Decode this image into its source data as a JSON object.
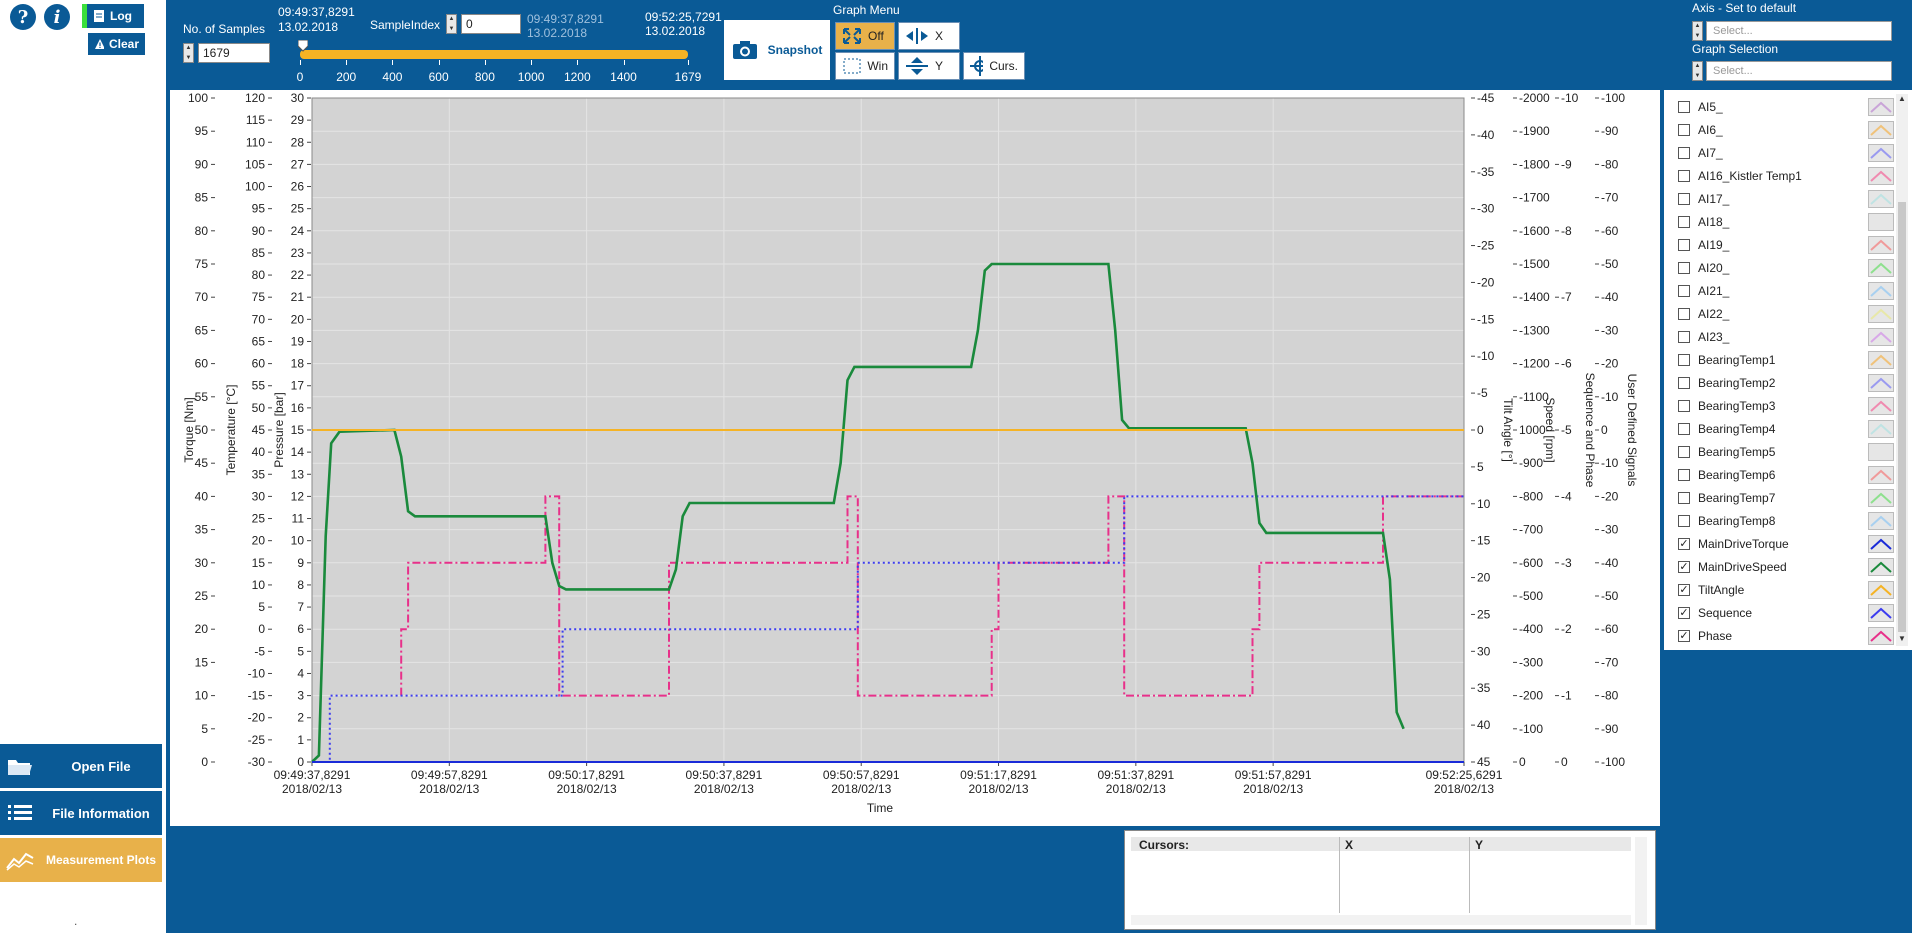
{
  "left": {
    "help_glyph": "?",
    "info_glyph": "i",
    "log_label": "Log",
    "clear_label": "Clear",
    "nav": [
      {
        "label": "Open File",
        "icon": "folder-icon"
      },
      {
        "label": "File Information",
        "icon": "list-icon"
      },
      {
        "label": "Measurement Plots",
        "icon": "chart-line-icon"
      }
    ],
    "footer_mark": "."
  },
  "toolbar": {
    "samples_label": "No. of Samples",
    "samples_value": "1679",
    "start_time": "09:49:37,8291",
    "start_date": "13.02.2018",
    "sample_index_label": "SampleIndex",
    "sample_index_value": "0",
    "index_time": "09:49:37,8291",
    "index_date": "13.02.2018",
    "end_time": "09:52:25,7291",
    "end_date": "13.02.2018",
    "slider_ticks": [
      "0",
      "200",
      "400",
      "600",
      "800",
      "1000",
      "1200",
      "1400",
      "1679"
    ],
    "slider_position": 0,
    "snapshot_label": "Snapshot",
    "graph_menu_label": "Graph Menu",
    "btn_off": "Off",
    "btn_x": "X",
    "btn_win": "Win",
    "btn_y": "Y",
    "btn_curs": "Curs.",
    "axis_default_label": "Axis - Set to default",
    "axis_select_placeholder": "Select...",
    "graph_selection_label": "Graph Selection",
    "graph_select_placeholder": "Select..."
  },
  "chart_data": {
    "type": "line",
    "xlabel": "Time",
    "x_ticks": [
      {
        "time": "09:49:37,8291",
        "date": "2018/02/13"
      },
      {
        "time": "09:49:57,8291",
        "date": "2018/02/13"
      },
      {
        "time": "09:50:17,8291",
        "date": "2018/02/13"
      },
      {
        "time": "09:50:37,8291",
        "date": "2018/02/13"
      },
      {
        "time": "09:50:57,8291",
        "date": "2018/02/13"
      },
      {
        "time": "09:51:17,8291",
        "date": "2018/02/13"
      },
      {
        "time": "09:51:37,8291",
        "date": "2018/02/13"
      },
      {
        "time": "09:51:57,8291",
        "date": "2018/02/13"
      },
      {
        "time": "09:52:25,6291",
        "date": "2018/02/13"
      }
    ],
    "x_seconds_ticks": [
      0,
      20,
      40,
      60,
      80,
      100,
      120,
      140,
      167.8
    ],
    "xlim": [
      0,
      167.8
    ],
    "left_axes": [
      {
        "label": "Torque [Nm]",
        "ticks": [
          "100",
          "95",
          "90",
          "85",
          "80",
          "75",
          "70",
          "65",
          "60",
          "55",
          "50",
          "45",
          "40",
          "35",
          "30",
          "25",
          "20",
          "15",
          "10",
          "5",
          "0"
        ]
      },
      {
        "label": "Temperature [°C]",
        "ticks": [
          "120",
          "115",
          "110",
          "105",
          "100",
          "95",
          "90",
          "85",
          "80",
          "75",
          "70",
          "65",
          "60",
          "55",
          "50",
          "45",
          "40",
          "35",
          "30",
          "25",
          "20",
          "15",
          "10",
          "5",
          "0",
          "-5",
          "-10",
          "-15",
          "-20",
          "-25",
          "-30"
        ]
      },
      {
        "label": "Pressure [bar]",
        "ticks": [
          "30",
          "29",
          "28",
          "27",
          "26",
          "25",
          "24",
          "23",
          "22",
          "21",
          "20",
          "19",
          "18",
          "17",
          "16",
          "15",
          "14",
          "13",
          "12",
          "11",
          "10",
          "9",
          "8",
          "7",
          "6",
          "5",
          "4",
          "3",
          "2",
          "1",
          "0"
        ]
      }
    ],
    "right_axes": [
      {
        "label": "Tilt Angle [°]",
        "ticks": [
          "-45",
          "-40",
          "-35",
          "-30",
          "-25",
          "-20",
          "-15",
          "-10",
          "-5",
          "0",
          "5",
          "10",
          "15",
          "20",
          "25",
          "30",
          "35",
          "40",
          "45"
        ],
        "order": "top_to_bottom_value_at_top_45"
      },
      {
        "label": "Speed [rpm]",
        "ticks": [
          "-2000",
          "-1900",
          "-1800",
          "-1700",
          "-1600",
          "-1500",
          "-1400",
          "-1300",
          "-1200",
          "-1100",
          "1000",
          "-900",
          "-800",
          "-700",
          "-600",
          "-500",
          "-400",
          "-300",
          "-200",
          "-100",
          "0"
        ]
      },
      {
        "label": "Sequence and Phase",
        "ticks": [
          "-10",
          "-9",
          "-8",
          "-7",
          "-6",
          "-5",
          "-4",
          "-3",
          "-2",
          "-1",
          "0"
        ]
      },
      {
        "label": "User Defined Signals",
        "ticks": [
          "-100",
          "-90",
          "-80",
          "-70",
          "-60",
          "-50",
          "-40",
          "-30",
          "-20",
          "-10",
          "0",
          "-10",
          "-20",
          "-30",
          "-40",
          "-50",
          "-60",
          "-70",
          "-80",
          "-90",
          "-100"
        ]
      }
    ],
    "series": [
      {
        "name": "MainDriveTorque",
        "color": "#1a2bd8",
        "style": "solid",
        "points": [
          [
            0,
            0
          ],
          [
            167.8,
            0
          ]
        ]
      },
      {
        "name": "MainDriveSpeed",
        "color": "#1a8a3c",
        "style": "solid",
        "unit_axis": "Speed [rpm] 0..2000",
        "points": [
          [
            0,
            0
          ],
          [
            1,
            20
          ],
          [
            2,
            680
          ],
          [
            2.8,
            960
          ],
          [
            4,
            995
          ],
          [
            12,
            1000
          ],
          [
            13,
            920
          ],
          [
            14,
            755
          ],
          [
            15,
            740
          ],
          [
            34,
            740
          ],
          [
            35,
            600
          ],
          [
            36,
            530
          ],
          [
            37,
            520
          ],
          [
            52,
            520
          ],
          [
            53,
            580
          ],
          [
            54,
            740
          ],
          [
            55,
            780
          ],
          [
            76,
            780
          ],
          [
            77,
            900
          ],
          [
            78,
            1150
          ],
          [
            79,
            1190
          ],
          [
            96,
            1190
          ],
          [
            97,
            1300
          ],
          [
            98,
            1480
          ],
          [
            99,
            1500
          ],
          [
            116,
            1500
          ],
          [
            117,
            1300
          ],
          [
            118,
            1030
          ],
          [
            119,
            1005
          ],
          [
            136,
            1005
          ],
          [
            137,
            900
          ],
          [
            138,
            720
          ],
          [
            139,
            690
          ],
          [
            156,
            690
          ],
          [
            157,
            550
          ],
          [
            158,
            150
          ],
          [
            159,
            100
          ]
        ]
      },
      {
        "name": "TiltAngle",
        "color": "#f5b324",
        "style": "solid",
        "unit_axis": "Tilt Angle [°] 0",
        "points": [
          [
            0,
            0
          ],
          [
            167.8,
            0
          ]
        ]
      },
      {
        "name": "Sequence",
        "color": "#3c3cf0",
        "style": "dotted",
        "unit_axis": "Sequence and Phase",
        "points": [
          [
            0,
            0
          ],
          [
            2.6,
            0
          ],
          [
            2.6,
            1
          ],
          [
            36.5,
            1
          ],
          [
            36.5,
            2
          ],
          [
            79.5,
            2
          ],
          [
            79.5,
            3
          ],
          [
            118.3,
            3
          ],
          [
            118.3,
            4
          ],
          [
            167.8,
            4
          ]
        ]
      },
      {
        "name": "Phase",
        "color": "#e8308a",
        "style": "dashdot",
        "unit_axis": "Sequence and Phase",
        "points": [
          [
            13,
            1
          ],
          [
            13,
            2
          ],
          [
            14,
            2
          ],
          [
            14,
            3
          ],
          [
            34,
            3
          ],
          [
            34,
            4
          ],
          [
            36,
            4
          ],
          [
            36,
            1
          ],
          [
            52,
            1
          ],
          [
            52,
            3
          ],
          [
            78,
            3
          ],
          [
            78,
            4
          ],
          [
            79.5,
            4
          ],
          [
            79.5,
            1
          ],
          [
            99,
            1
          ],
          [
            99,
            2
          ],
          [
            100,
            2
          ],
          [
            100,
            3
          ],
          [
            116,
            3
          ],
          [
            116,
            4
          ],
          [
            118.3,
            4
          ],
          [
            118.3,
            1
          ],
          [
            137,
            1
          ],
          [
            137,
            2
          ],
          [
            138,
            2
          ],
          [
            138,
            3
          ],
          [
            156,
            3
          ],
          [
            156,
            4
          ],
          [
            167.8,
            4
          ]
        ]
      }
    ],
    "grid": true
  },
  "legend": {
    "items": [
      {
        "label": "AI5_",
        "checked": false,
        "color": "#c9a4d8"
      },
      {
        "label": "AI6_",
        "checked": false,
        "color": "#f0c27a"
      },
      {
        "label": "AI7_",
        "checked": false,
        "color": "#9a9af0"
      },
      {
        "label": "AI16_Kistler Temp1",
        "checked": false,
        "color": "#f08ab0"
      },
      {
        "label": "AI17_",
        "checked": false,
        "color": "#bfe3e3"
      },
      {
        "label": "AI18_",
        "checked": false,
        "color": "#e6e6e6"
      },
      {
        "label": "AI19_",
        "checked": false,
        "color": "#f09a9a"
      },
      {
        "label": "AI20_",
        "checked": false,
        "color": "#8ee08e"
      },
      {
        "label": "AI21_",
        "checked": false,
        "color": "#a8d0f0"
      },
      {
        "label": "AI22_",
        "checked": false,
        "color": "#e8e8a8"
      },
      {
        "label": "AI23_",
        "checked": false,
        "color": "#d8a8e8"
      },
      {
        "label": "BearingTemp1",
        "checked": false,
        "color": "#f0c27a"
      },
      {
        "label": "BearingTemp2",
        "checked": false,
        "color": "#9a9af0"
      },
      {
        "label": "BearingTemp3",
        "checked": false,
        "color": "#f08ab0"
      },
      {
        "label": "BearingTemp4",
        "checked": false,
        "color": "#bfe3e3"
      },
      {
        "label": "BearingTemp5",
        "checked": false,
        "color": "#e6e6e6"
      },
      {
        "label": "BearingTemp6",
        "checked": false,
        "color": "#f09a9a"
      },
      {
        "label": "BearingTemp7",
        "checked": false,
        "color": "#8ee08e"
      },
      {
        "label": "BearingTemp8",
        "checked": false,
        "color": "#a8d0f0"
      },
      {
        "label": "MainDriveTorque",
        "checked": true,
        "color": "#1a2bd8"
      },
      {
        "label": "MainDriveSpeed",
        "checked": true,
        "color": "#1a8a3c"
      },
      {
        "label": "TiltAngle",
        "checked": true,
        "color": "#f5b324"
      },
      {
        "label": "Sequence",
        "checked": true,
        "color": "#3c3cf0"
      },
      {
        "label": "Phase",
        "checked": true,
        "color": "#e8308a"
      }
    ]
  },
  "cursors": {
    "col_cursors": "Cursors:",
    "col_x": "X",
    "col_y": "Y"
  }
}
